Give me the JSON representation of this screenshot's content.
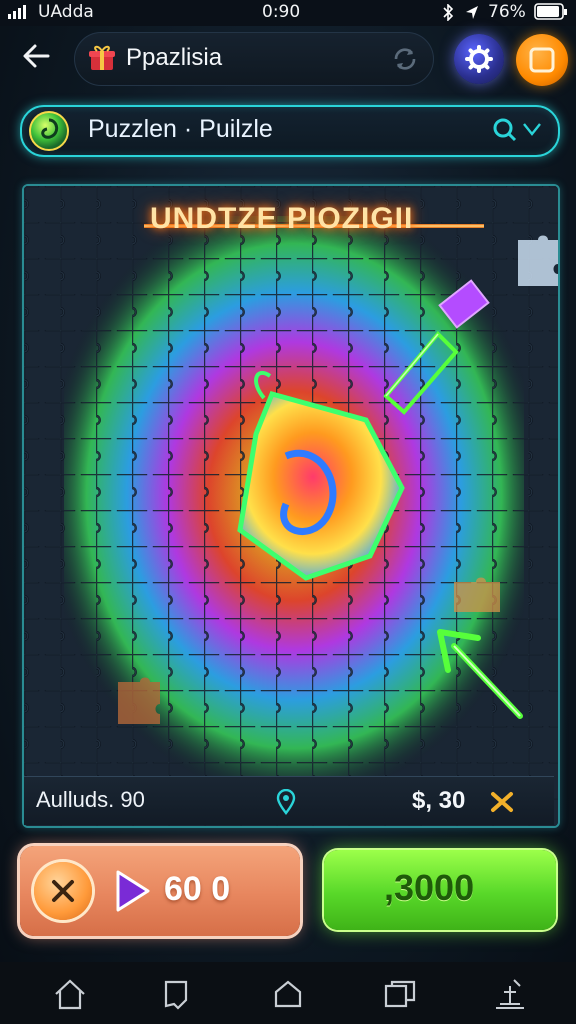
{
  "status_bar": {
    "carrier": "UAdda",
    "time": "0:90",
    "battery": "76%"
  },
  "header": {
    "title": "Ppazlisia"
  },
  "search": {
    "value": "Puzzlen · Puilzle"
  },
  "board": {
    "banner": "UNDTZE PIOZIGII",
    "info_left": "Aulluds. 90",
    "info_right": "$, 30"
  },
  "actions": {
    "left_value": "60 0",
    "right_label": ",3000"
  },
  "colors": {
    "accent_cyan": "#2ad4d9",
    "neon_green": "#58d829",
    "orange": "#ff8a00",
    "coral": "#e7865e"
  }
}
